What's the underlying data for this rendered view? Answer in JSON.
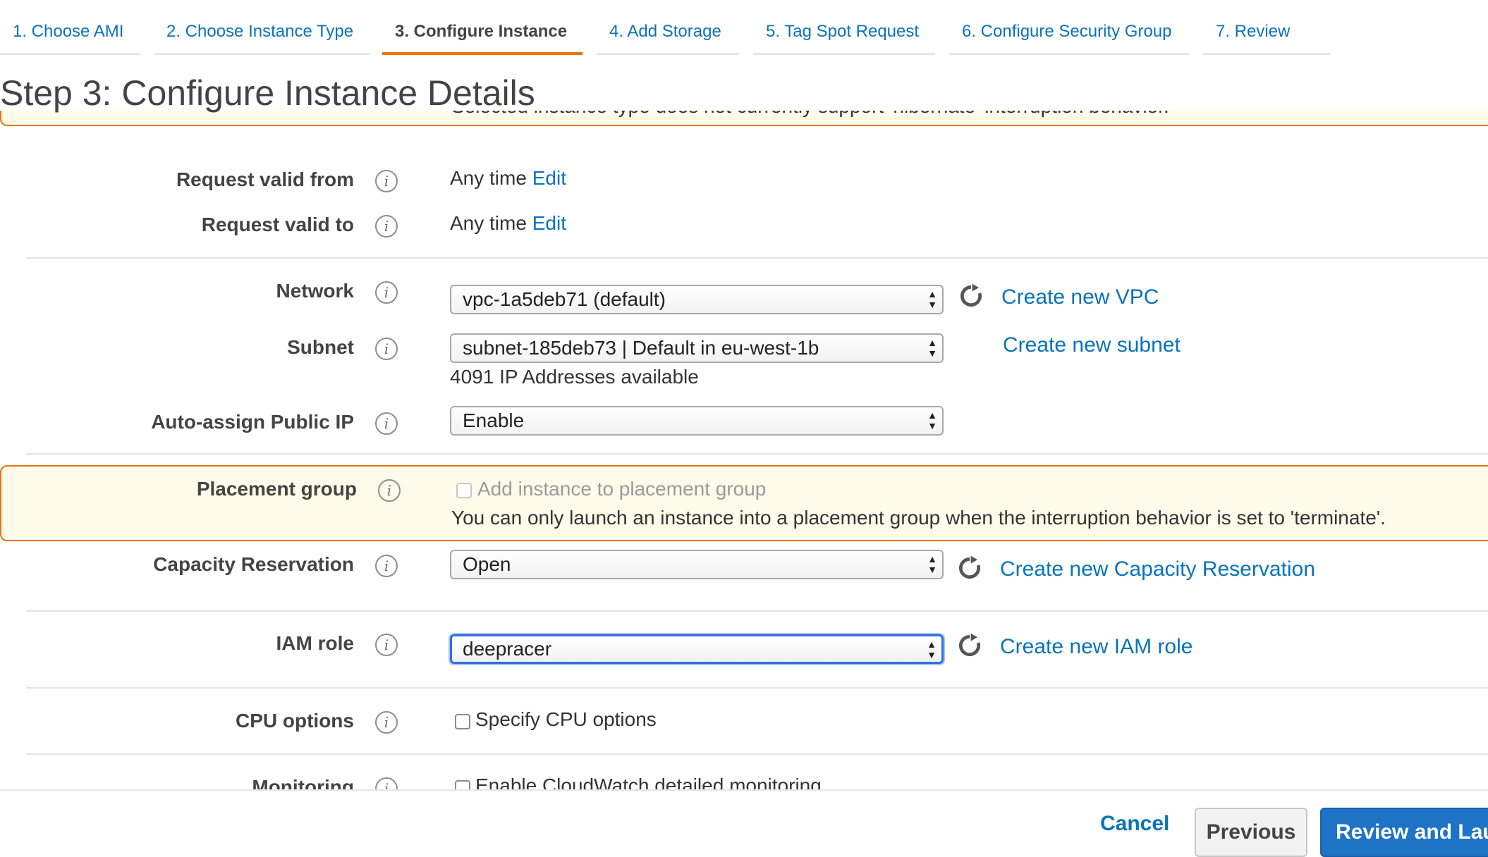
{
  "tabs": [
    {
      "label": "1. Choose AMI"
    },
    {
      "label": "2. Choose Instance Type"
    },
    {
      "label": "3. Configure Instance"
    },
    {
      "label": "4. Add Storage"
    },
    {
      "label": "5. Tag Spot Request"
    },
    {
      "label": "6. Configure Security Group"
    },
    {
      "label": "7. Review"
    }
  ],
  "active_tab": "3. Configure Instance",
  "page_title": "Step 3: Configure Instance Details",
  "interruption_warning": "Selected instance type does not currently support 'hibernate' interruption behavior.",
  "request_valid_from": {
    "label": "Request valid from",
    "value": "Any time",
    "edit": "Edit"
  },
  "request_valid_to": {
    "label": "Request valid to",
    "value": "Any time",
    "edit": "Edit"
  },
  "network": {
    "label": "Network",
    "value": "vpc-1a5deb71 (default)",
    "create_link": "Create new VPC"
  },
  "subnet": {
    "label": "Subnet",
    "value": "subnet-185deb73 | Default in eu-west-1b",
    "note": "4091 IP Addresses available",
    "create_link": "Create new subnet"
  },
  "auto_assign_ip": {
    "label": "Auto-assign Public IP",
    "value": "Enable"
  },
  "placement_group": {
    "label": "Placement group",
    "checkbox_label": "Add instance to placement group",
    "checked": false,
    "disabled": true,
    "warning": "You can only launch an instance into a placement group when the interruption behavior is set to 'terminate'."
  },
  "capacity_reservation": {
    "label": "Capacity Reservation",
    "value": "Open",
    "create_link": "Create new Capacity Reservation"
  },
  "iam_role": {
    "label": "IAM role",
    "value": "deepracer",
    "create_link": "Create new IAM role"
  },
  "cpu_options": {
    "label": "CPU options",
    "checkbox_label": "Specify CPU options",
    "checked": false
  },
  "monitoring": {
    "label": "Monitoring",
    "checkbox_label": "Enable CloudWatch detailed monitoring",
    "checked": false
  },
  "footer": {
    "cancel": "Cancel",
    "previous": "Previous",
    "review": "Review and Launch"
  },
  "colors": {
    "accent_orange": "#ec7211",
    "link_blue": "#0a73bb",
    "primary_blue": "#1e73c7",
    "warning_bg": "#fffbea"
  },
  "icons": {
    "info": "info-icon",
    "refresh": "refresh-icon"
  }
}
